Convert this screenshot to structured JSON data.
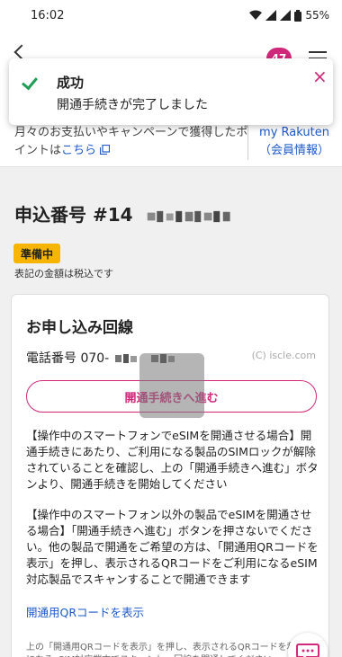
{
  "status_bar": {
    "time": "16:02",
    "battery": "55%"
  },
  "header": {
    "notification_count": "47"
  },
  "toast": {
    "title": "成功",
    "message": "開通手続きが完了しました"
  },
  "points": {
    "text": "月々のお支払いやキャンペーンで獲得したポイントは",
    "link": "こちら",
    "account_link": "my Rakuten（会員情報）"
  },
  "order": {
    "title": "申込番号 #14",
    "status": "準備中",
    "tax_note": "表記の金額は税込です"
  },
  "line": {
    "title": "お申し込み回線",
    "phone_label": "電話番号 070-",
    "watermark": "(C) iscle.com",
    "activate_button": "開通手続きへ進む",
    "para1": "【操作中のスマートフォンでeSIMを開通させる場合】開通手続きにあたり、ご利用になる製品のSIMロックが解除されていることを確認し、上の「開通手続きへ進む」ボタンより、開通手続きを開始してください",
    "para2": "【操作中のスマートフォン以外の製品でeSIMを開通させる場合】「開通手続きへ進む」ボタンを押さないでください。他の製品で開通をご希望の方は、「開通用QRコードを表示」を押し、表示されるQRコードをご利用になるeSIM対応製品でスキャンすることで開通できます",
    "qr_link": "開通用QRコードを表示",
    "fine_print": "上の「開通用QRコードを表示」を押し、表示されるQRコードを利用になるeSIM対応端末でスキャンし、回線を開通してください"
  },
  "colors": {
    "accent": "#d0287a",
    "link": "#1e5ac8",
    "success": "#1f9d57",
    "badge": "#f7b500"
  }
}
